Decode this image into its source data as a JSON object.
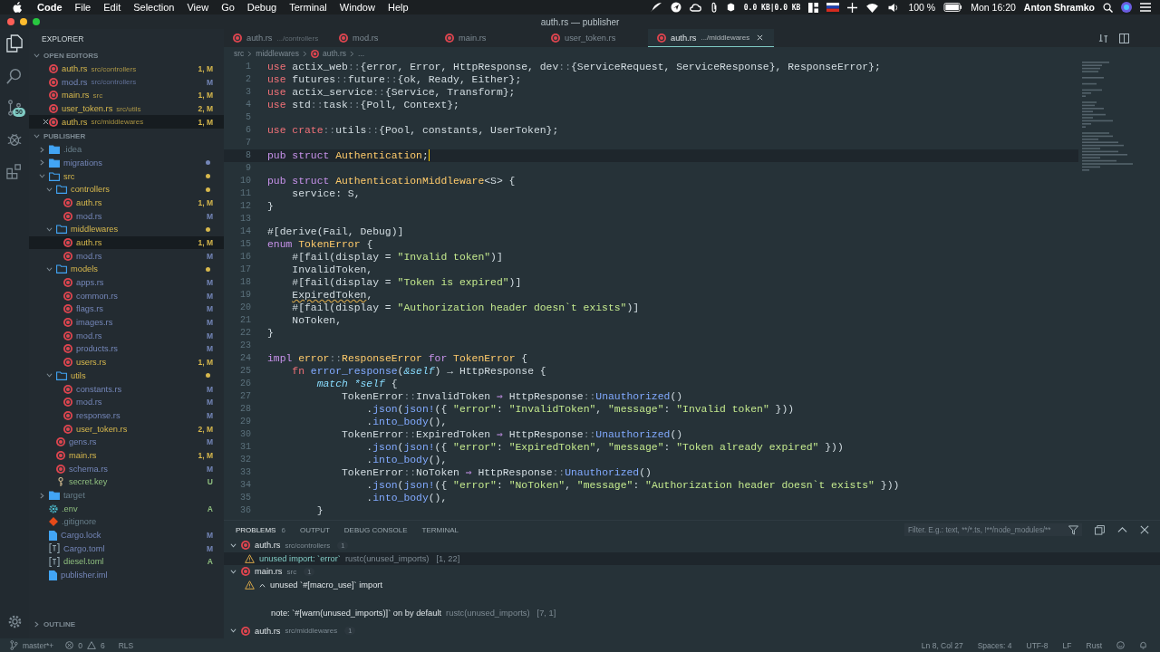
{
  "menubar": {
    "app": "Code",
    "items": [
      "File",
      "Edit",
      "Selection",
      "View",
      "Go",
      "Debug",
      "Terminal",
      "Window",
      "Help"
    ],
    "network": "0.0 KB|0.0 KB",
    "battery": "100 %",
    "clock": "Mon 16:20",
    "user": "Anton Shramko"
  },
  "window": {
    "title": "auth.rs — publisher"
  },
  "activity_bar": {
    "scm_badge": "50"
  },
  "sidebar": {
    "title": "EXPLORER",
    "open_editors": {
      "title": "OPEN EDITORS",
      "items": [
        {
          "name": "auth.rs",
          "path": "src/controllers",
          "badge": "1, M",
          "problems": true,
          "selected": false
        },
        {
          "name": "mod.rs",
          "path": "src/controllers",
          "badge": "M",
          "problems": false,
          "selected": false
        },
        {
          "name": "main.rs",
          "path": "src",
          "badge": "1, M",
          "problems": true,
          "selected": false
        },
        {
          "name": "user_token.rs",
          "path": "src/utils",
          "badge": "2, M",
          "problems": true,
          "selected": false
        },
        {
          "name": "auth.rs",
          "path": "src/middlewares",
          "badge": "1, M",
          "problems": true,
          "selected": true
        }
      ]
    },
    "project": {
      "title": "PUBLISHER",
      "tree": [
        {
          "kind": "folder",
          "name": ".idea",
          "ignored": true,
          "expanded": false,
          "selected": false
        },
        {
          "kind": "folder",
          "name": "migrations",
          "problems": false,
          "dot": true,
          "expanded": false,
          "selected": false
        },
        {
          "kind": "folder",
          "name": "src",
          "problems": true,
          "dot": true,
          "expanded": true,
          "selected": false,
          "children": [
            {
              "kind": "folder",
              "name": "controllers",
              "problems": true,
              "dot": true,
              "expanded": true,
              "selected": false,
              "children": [
                {
                  "kind": "rust",
                  "name": "auth.rs",
                  "badge": "1, M",
                  "problems": true,
                  "selected": false
                },
                {
                  "kind": "rust",
                  "name": "mod.rs",
                  "badge": "M",
                  "problems": false,
                  "selected": false
                }
              ]
            },
            {
              "kind": "folder",
              "name": "middlewares",
              "problems": true,
              "dot": true,
              "expanded": true,
              "selected": false,
              "children": [
                {
                  "kind": "rust",
                  "name": "auth.rs",
                  "badge": "1, M",
                  "problems": true,
                  "selected": true
                },
                {
                  "kind": "rust",
                  "name": "mod.rs",
                  "badge": "M",
                  "problems": false,
                  "selected": false
                }
              ]
            },
            {
              "kind": "folder",
              "name": "models",
              "problems": true,
              "dot": true,
              "expanded": true,
              "selected": false,
              "children": [
                {
                  "kind": "rust",
                  "name": "apps.rs",
                  "badge": "M",
                  "problems": false,
                  "selected": false
                },
                {
                  "kind": "rust",
                  "name": "common.rs",
                  "badge": "M",
                  "problems": false,
                  "selected": false
                },
                {
                  "kind": "rust",
                  "name": "flags.rs",
                  "badge": "M",
                  "problems": false,
                  "selected": false
                },
                {
                  "kind": "rust",
                  "name": "images.rs",
                  "badge": "M",
                  "problems": false,
                  "selected": false
                },
                {
                  "kind": "rust",
                  "name": "mod.rs",
                  "badge": "M",
                  "problems": false,
                  "selected": false
                },
                {
                  "kind": "rust",
                  "name": "products.rs",
                  "badge": "M",
                  "problems": false,
                  "selected": false
                },
                {
                  "kind": "rust",
                  "name": "users.rs",
                  "badge": "1, M",
                  "problems": true,
                  "selected": false
                }
              ]
            },
            {
              "kind": "folder",
              "name": "utils",
              "problems": true,
              "dot": true,
              "expanded": true,
              "selected": false,
              "children": [
                {
                  "kind": "rust",
                  "name": "constants.rs",
                  "badge": "M",
                  "problems": false,
                  "selected": false
                },
                {
                  "kind": "rust",
                  "name": "mod.rs",
                  "badge": "M",
                  "problems": false,
                  "selected": false
                },
                {
                  "kind": "rust",
                  "name": "response.rs",
                  "badge": "M",
                  "problems": false,
                  "selected": false
                },
                {
                  "kind": "rust",
                  "name": "user_token.rs",
                  "badge": "2, M",
                  "problems": true,
                  "selected": false
                }
              ]
            },
            {
              "kind": "rust",
              "name": "gens.rs",
              "badge": "M",
              "problems": false,
              "selected": false
            },
            {
              "kind": "rust",
              "name": "main.rs",
              "badge": "1, M",
              "problems": true,
              "selected": false
            },
            {
              "kind": "rust",
              "name": "schema.rs",
              "badge": "M",
              "problems": false,
              "selected": false
            },
            {
              "kind": "key",
              "name": "secret.key",
              "badge": "U",
              "problems": false,
              "added": true,
              "selected": false
            }
          ]
        },
        {
          "kind": "folder",
          "name": "target",
          "ignored": true,
          "expanded": false,
          "selected": false
        },
        {
          "kind": "gear",
          "name": ".env",
          "badge": "A",
          "problems": false,
          "added": true,
          "selected": false
        },
        {
          "kind": "git",
          "name": ".gitignore",
          "ignored": true,
          "selected": false
        },
        {
          "kind": "file",
          "name": "Cargo.lock",
          "badge": "M",
          "problems": false,
          "selected": false
        },
        {
          "kind": "toml",
          "name": "Cargo.toml",
          "badge": "M",
          "problems": false,
          "selected": false
        },
        {
          "kind": "toml",
          "name": "diesel.toml",
          "badge": "A",
          "problems": false,
          "added": true,
          "selected": false
        },
        {
          "kind": "file",
          "name": "publisher.iml",
          "problems": false,
          "selected": false
        }
      ]
    },
    "outline": "OUTLINE"
  },
  "tabs": [
    {
      "label": "auth.rs",
      "path": ".../controllers",
      "selected": false
    },
    {
      "label": "mod.rs",
      "selected": false
    },
    {
      "label": "main.rs",
      "selected": false
    },
    {
      "label": "user_token.rs",
      "selected": false
    },
    {
      "label": "auth.rs",
      "path": ".../middlewares",
      "selected": true
    }
  ],
  "breadcrumb": [
    "src",
    "middlewares",
    "auth.rs",
    "..."
  ],
  "code": [
    {
      "n": "1",
      "current": false,
      "tokens": [
        {
          "text": "use",
          "kind": "imp"
        },
        {
          "text": " actix_web"
        },
        {
          "text": "::",
          "kind": "op"
        },
        {
          "text": "{error, Error, HttpResponse, dev"
        },
        {
          "text": "::",
          "kind": "op"
        },
        {
          "text": "{ServiceRequest, ServiceResponse}, ResponseError};"
        }
      ]
    },
    {
      "n": "2",
      "current": false,
      "tokens": [
        {
          "text": "use",
          "kind": "imp"
        },
        {
          "text": " futures"
        },
        {
          "text": "::",
          "kind": "op"
        },
        {
          "text": "future"
        },
        {
          "text": "::",
          "kind": "op"
        },
        {
          "text": "{ok, Ready, Either};"
        }
      ]
    },
    {
      "n": "3",
      "current": false,
      "tokens": [
        {
          "text": "use",
          "kind": "imp"
        },
        {
          "text": " actix_service"
        },
        {
          "text": "::",
          "kind": "op"
        },
        {
          "text": "{Service, Transform};"
        }
      ]
    },
    {
      "n": "4",
      "current": false,
      "tokens": [
        {
          "text": "use",
          "kind": "imp"
        },
        {
          "text": " std"
        },
        {
          "text": "::",
          "kind": "op"
        },
        {
          "text": "task"
        },
        {
          "text": "::",
          "kind": "op"
        },
        {
          "text": "{Poll, Context};"
        }
      ]
    },
    {
      "n": "5",
      "current": false
    },
    {
      "n": "6",
      "current": false,
      "tokens": [
        {
          "text": "use crate",
          "kind": "imp"
        },
        {
          "text": "::",
          "kind": "op"
        },
        {
          "text": "utils"
        },
        {
          "text": "::",
          "kind": "op"
        },
        {
          "text": "{Pool, constants, UserToken};"
        }
      ]
    },
    {
      "n": "7",
      "current": false
    },
    {
      "n": "8",
      "current": true,
      "tokens": [
        {
          "text": "pub struct ",
          "kind": "kw"
        },
        {
          "text": "Authentication",
          "kind": "type"
        },
        {
          "text": ";"
        }
      ]
    },
    {
      "n": "9",
      "current": false
    },
    {
      "n": "10",
      "current": false,
      "tokens": [
        {
          "text": "pub struct ",
          "kind": "kw"
        },
        {
          "text": "AuthenticationMiddleware",
          "kind": "type"
        },
        {
          "text": "<S> {"
        }
      ]
    },
    {
      "n": "11",
      "current": false,
      "tokens": [
        {
          "text": "    service: S,"
        }
      ]
    },
    {
      "n": "12",
      "current": false,
      "tokens": [
        {
          "text": "}"
        }
      ]
    },
    {
      "n": "13",
      "current": false
    },
    {
      "n": "14",
      "current": false,
      "tokens": [
        {
          "text": "#[derive(Fail, Debug)]"
        }
      ]
    },
    {
      "n": "15",
      "current": false,
      "tokens": [
        {
          "text": "enum ",
          "kind": "kw"
        },
        {
          "text": "TokenError",
          "kind": "type"
        },
        {
          "text": " {"
        }
      ]
    },
    {
      "n": "16",
      "current": false,
      "tokens": [
        {
          "text": "    #[fail(display = "
        },
        {
          "text": "\"Invalid token\"",
          "kind": "str"
        },
        {
          "text": ")]"
        }
      ]
    },
    {
      "n": "17",
      "current": false,
      "tokens": [
        {
          "text": "    InvalidToken,"
        }
      ]
    },
    {
      "n": "18",
      "current": false,
      "tokens": [
        {
          "text": "    #[fail(display = "
        },
        {
          "text": "\"Token is expired\"",
          "kind": "str"
        },
        {
          "text": ")]"
        }
      ]
    },
    {
      "n": "19",
      "current": false,
      "tokens": [
        {
          "text": "    ExpiredToken",
          "kind": "warn"
        },
        {
          "text": ","
        }
      ]
    },
    {
      "n": "20",
      "current": false,
      "tokens": [
        {
          "text": "    #[fail(display = "
        },
        {
          "text": "\"Authorization header doesn`t exists\"",
          "kind": "str"
        },
        {
          "text": ")]"
        }
      ]
    },
    {
      "n": "21",
      "current": false,
      "tokens": [
        {
          "text": "    NoToken,"
        }
      ]
    },
    {
      "n": "22",
      "current": false,
      "tokens": [
        {
          "text": "}"
        }
      ]
    },
    {
      "n": "23",
      "current": false
    },
    {
      "n": "24",
      "current": false,
      "tokens": [
        {
          "text": "impl ",
          "kind": "kw"
        },
        {
          "text": "error",
          "kind": "type"
        },
        {
          "text": "::",
          "kind": "op"
        },
        {
          "text": "ResponseError",
          "kind": "type"
        },
        {
          "text": " for ",
          "kind": "kw"
        },
        {
          "text": "TokenError",
          "kind": "type"
        },
        {
          "text": " {"
        }
      ]
    },
    {
      "n": "25",
      "current": false,
      "tokens": [
        {
          "text": "    fn ",
          "kind": "imp"
        },
        {
          "text": "error_response",
          "kind": "fn"
        },
        {
          "text": "("
        },
        {
          "text": "&self",
          "kind": "it"
        },
        {
          "text": ") → HttpResponse {"
        }
      ]
    },
    {
      "n": "26",
      "current": false,
      "tokens": [
        {
          "text": "        match *self",
          "kind": "it"
        },
        {
          "text": " {"
        }
      ]
    },
    {
      "n": "27",
      "current": false,
      "tokens": [
        {
          "text": "            TokenError"
        },
        {
          "text": "::",
          "kind": "op"
        },
        {
          "text": "InvalidToken "
        },
        {
          "text": "⇒",
          "kind": "kw"
        },
        {
          "text": " HttpResponse"
        },
        {
          "text": "::",
          "kind": "op"
        },
        {
          "text": "Unauthorized",
          "kind": "fn"
        },
        {
          "text": "()"
        }
      ]
    },
    {
      "n": "28",
      "current": false,
      "tokens": [
        {
          "text": "                ."
        },
        {
          "text": "json",
          "kind": "fn"
        },
        {
          "text": "("
        },
        {
          "text": "json!",
          "kind": "fn"
        },
        {
          "text": "({ "
        },
        {
          "text": "\"error\"",
          "kind": "str"
        },
        {
          "text": ": "
        },
        {
          "text": "\"InvalidToken\"",
          "kind": "str"
        },
        {
          "text": ", "
        },
        {
          "text": "\"message\"",
          "kind": "str"
        },
        {
          "text": ": "
        },
        {
          "text": "\"Invalid token\"",
          "kind": "str"
        },
        {
          "text": " }))"
        }
      ]
    },
    {
      "n": "29",
      "current": false,
      "tokens": [
        {
          "text": "                ."
        },
        {
          "text": "into_body",
          "kind": "fn"
        },
        {
          "text": "(),"
        }
      ]
    },
    {
      "n": "30",
      "current": false,
      "tokens": [
        {
          "text": "            TokenError"
        },
        {
          "text": "::",
          "kind": "op"
        },
        {
          "text": "ExpiredToken "
        },
        {
          "text": "⇒",
          "kind": "kw"
        },
        {
          "text": " HttpResponse"
        },
        {
          "text": "::",
          "kind": "op"
        },
        {
          "text": "Unauthorized",
          "kind": "fn"
        },
        {
          "text": "()"
        }
      ]
    },
    {
      "n": "31",
      "current": false,
      "tokens": [
        {
          "text": "                ."
        },
        {
          "text": "json",
          "kind": "fn"
        },
        {
          "text": "("
        },
        {
          "text": "json!",
          "kind": "fn"
        },
        {
          "text": "({ "
        },
        {
          "text": "\"error\"",
          "kind": "str"
        },
        {
          "text": ": "
        },
        {
          "text": "\"ExpiredToken\"",
          "kind": "str"
        },
        {
          "text": ", "
        },
        {
          "text": "\"message\"",
          "kind": "str"
        },
        {
          "text": ": "
        },
        {
          "text": "\"Token already expired\"",
          "kind": "str"
        },
        {
          "text": " }))"
        }
      ]
    },
    {
      "n": "32",
      "current": false,
      "tokens": [
        {
          "text": "                ."
        },
        {
          "text": "into_body",
          "kind": "fn"
        },
        {
          "text": "(),"
        }
      ]
    },
    {
      "n": "33",
      "current": false,
      "tokens": [
        {
          "text": "            TokenError"
        },
        {
          "text": "::",
          "kind": "op"
        },
        {
          "text": "NoToken "
        },
        {
          "text": "⇒",
          "kind": "kw"
        },
        {
          "text": " HttpResponse"
        },
        {
          "text": "::",
          "kind": "op"
        },
        {
          "text": "Unauthorized",
          "kind": "fn"
        },
        {
          "text": "()"
        }
      ]
    },
    {
      "n": "34",
      "current": false,
      "tokens": [
        {
          "text": "                ."
        },
        {
          "text": "json",
          "kind": "fn"
        },
        {
          "text": "("
        },
        {
          "text": "json!",
          "kind": "fn"
        },
        {
          "text": "({ "
        },
        {
          "text": "\"error\"",
          "kind": "str"
        },
        {
          "text": ": "
        },
        {
          "text": "\"NoToken\"",
          "kind": "str"
        },
        {
          "text": ", "
        },
        {
          "text": "\"message\"",
          "kind": "str"
        },
        {
          "text": ": "
        },
        {
          "text": "\"Authorization header doesn`t exists\"",
          "kind": "str"
        },
        {
          "text": " }))"
        }
      ]
    },
    {
      "n": "35",
      "current": false,
      "tokens": [
        {
          "text": "                ."
        },
        {
          "text": "into_body",
          "kind": "fn"
        },
        {
          "text": "(),"
        }
      ]
    },
    {
      "n": "36",
      "current": false,
      "tokens": [
        {
          "text": "        }"
        }
      ]
    }
  ],
  "panel": {
    "tabs": [
      {
        "label": "PROBLEMS",
        "count": "6",
        "selected": true
      },
      {
        "label": "OUTPUT",
        "selected": false
      },
      {
        "label": "DEBUG CONSOLE",
        "selected": false
      },
      {
        "label": "TERMINAL",
        "selected": false
      }
    ],
    "filter": {
      "placeholder": "Filter. E.g.: text, **/*.ts, !**/node_modules/**"
    },
    "groups": [
      {
        "file": "auth.rs",
        "path": "src/controllers",
        "count": "1",
        "expanded": true,
        "items": [
          {
            "kind": "warning",
            "message": "unused import: `error`",
            "source": "rustc(unused_imports)",
            "location": "[1, 22]",
            "selected": true
          }
        ]
      },
      {
        "file": "main.rs",
        "path": "src",
        "count": "1",
        "expanded": true,
        "items": [
          {
            "kind": "warning",
            "message": "unused `#[macro_use]` import",
            "selected": false
          },
          {
            "kind": "note",
            "message": "note: `#[warn(unused_imports)]` on by default",
            "source": "rustc(unused_imports)",
            "location": "[7, 1]",
            "selected": false
          }
        ]
      },
      {
        "file": "auth.rs",
        "path": "src/middlewares",
        "count": "1",
        "expanded": true
      }
    ]
  },
  "status_bar": {
    "branch": "master*+",
    "errors": "0",
    "warnings": "6",
    "server": "RLS",
    "position": "Ln 8, Col 27",
    "indent": "Spaces: 4",
    "encoding": "UTF-8",
    "eol": "LF",
    "language": "Rust"
  }
}
